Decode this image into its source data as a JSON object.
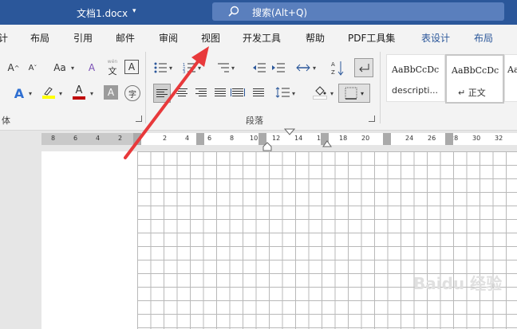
{
  "titlebar": {
    "doc_title": "文档1.docx",
    "search_text": "搜索(Alt+Q)"
  },
  "tabs": [
    "计",
    "布局",
    "引用",
    "邮件",
    "审阅",
    "视图",
    "开发工具",
    "帮助",
    "PDF工具集",
    "表设计",
    "布局"
  ],
  "ribbon": {
    "font": {
      "grow": "A",
      "shrink": "A",
      "font_color_a": "A",
      "aa": "Aa",
      "clear": "A",
      "wen": "文",
      "char_border": "A",
      "text_effect": "A",
      "highlight": "ab",
      "font_color": "A",
      "shade": "A",
      "circle": "字",
      "group_label": "体"
    },
    "paragraph": {
      "group_label": "段落"
    },
    "styles": [
      {
        "sample": "AaBbCcDc",
        "name": "descripti..."
      },
      {
        "sample": "AaBbCcDc",
        "name": "↵ 正文"
      },
      {
        "sample": "Aa",
        "name": ""
      }
    ]
  },
  "ruler": {
    "labels": [
      "8",
      "6",
      "4",
      "2",
      "2",
      "4",
      "6",
      "8",
      "10",
      "12",
      "14",
      "16",
      "18",
      "20",
      "24",
      "26",
      "28",
      "30",
      "32"
    ]
  },
  "watermark": "Baidu 经验",
  "colors": {
    "titlebar": "#2b579a",
    "search": "#5a7fbd",
    "arrow": "#e8393b",
    "highlight": "#ffff00",
    "font_color": "#c00000"
  }
}
